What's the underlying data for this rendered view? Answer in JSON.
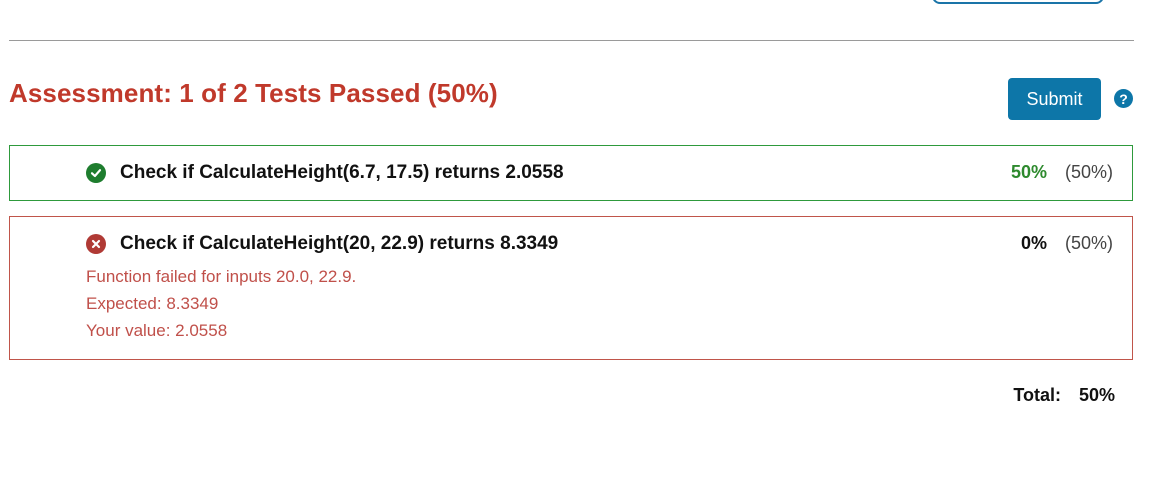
{
  "assessment": {
    "title": "Assessment: 1 of 2 Tests Passed (50%)",
    "submit_label": "Submit",
    "help_glyph": "?"
  },
  "tests": [
    {
      "status": "pass",
      "status_icon": "check-circle-icon",
      "title": "Check if CalculateHeight(6.7, 17.5) returns 2.0558",
      "score_earned": "50%",
      "score_weight": "(50%)"
    },
    {
      "status": "fail",
      "status_icon": "x-circle-icon",
      "title": "Check if CalculateHeight(20, 22.9) returns 8.3349",
      "score_earned": "0%",
      "score_weight": "(50%)",
      "details": [
        "Function failed for inputs 20.0, 22.9.",
        "Expected: 8.3349",
        "Your value: 2.0558"
      ]
    }
  ],
  "total": {
    "label": "Total:",
    "value": "50%"
  },
  "colors": {
    "fail_red": "#c0392b",
    "pass_green": "#2e8a2e",
    "primary_blue": "#0d76a8"
  }
}
